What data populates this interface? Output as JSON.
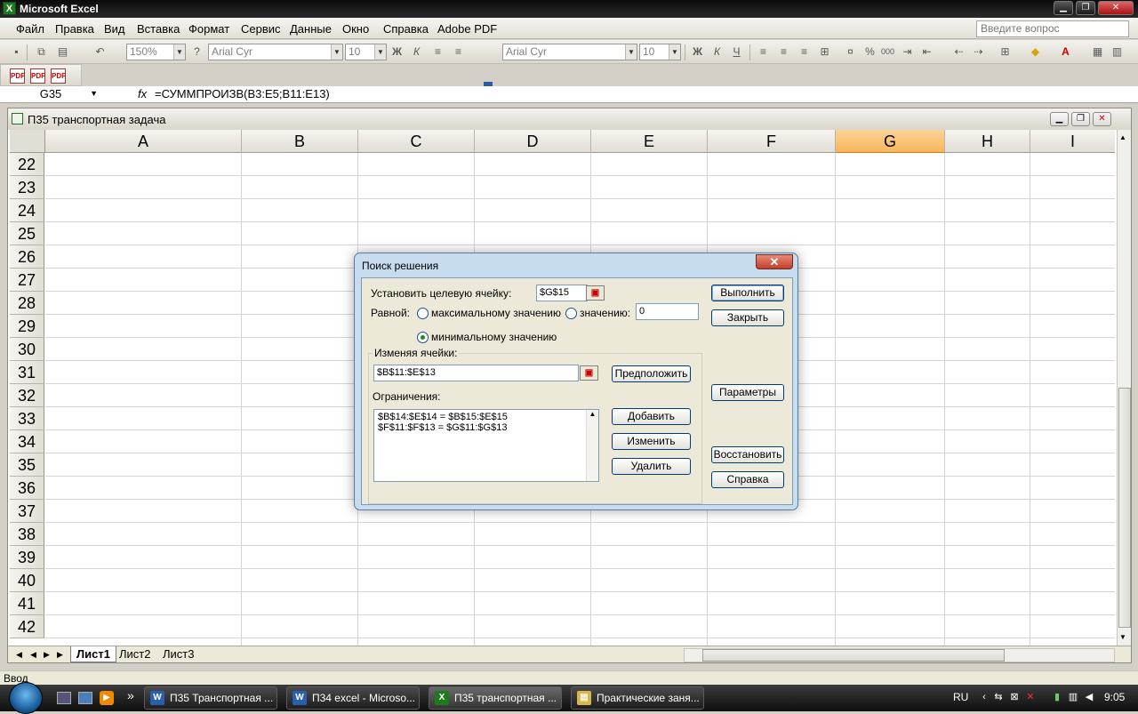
{
  "window": {
    "title": "Microsoft Excel",
    "app_icon": "X"
  },
  "menu": {
    "items": [
      "Файл",
      "Правка",
      "Вид",
      "Вставка",
      "Формат",
      "Сервис",
      "Данные",
      "Окно",
      "Справка",
      "Adobe PDF"
    ],
    "ask_placeholder": "Введите вопрос"
  },
  "toolbar": {
    "zoom": "150%",
    "font1": "Arial Cyr",
    "size1": "10",
    "font2": "Arial Cyr",
    "size2": "10",
    "bold": "Ж",
    "italic": "К",
    "underline": "Ч",
    "percent": "%",
    "thousands": "000"
  },
  "formula_bar": {
    "cell": "G35",
    "fx": "fx",
    "formula": "=СУММПРОИЗВ(B3:E5;B11:E13)"
  },
  "workbook": {
    "title": "П35 транспортная задача",
    "columns": [
      "A",
      "B",
      "C",
      "D",
      "E",
      "F",
      "G",
      "H",
      "I"
    ],
    "rows": [
      "22",
      "23",
      "24",
      "25",
      "26",
      "27",
      "28",
      "29",
      "30",
      "31",
      "32",
      "33",
      "34",
      "35",
      "36",
      "37",
      "38",
      "39",
      "40",
      "41",
      "42"
    ],
    "tabs": [
      "Лист1",
      "Лист2",
      "Лист3"
    ]
  },
  "status": {
    "text": "Ввод"
  },
  "dialog": {
    "title": "Поиск решения",
    "target_label": "Установить целевую ячейку:",
    "target_value": "$G$15",
    "equal_label": "Равной:",
    "max_label": "максимальному значению",
    "value_label": "значению:",
    "value_input": "0",
    "min_label": "минимальному значению",
    "changing_label": "Изменяя ячейки:",
    "changing_value": "$B$11:$E$13",
    "guess_button": "Предположить",
    "constraints_label": "Ограничения:",
    "constraints": [
      "$B$14:$E$14 = $B$15:$E$15",
      "$F$11:$F$13 = $G$11:$G$13"
    ],
    "add_button": "Добавить",
    "change_button": "Изменить",
    "delete_button": "Удалить",
    "solve_button": "Выполнить",
    "close_button": "Закрыть",
    "options_button": "Параметры",
    "reset_button": "Восстановить",
    "help_button": "Справка"
  },
  "taskbar": {
    "tasks": [
      "П35 Транспортная ...",
      "П34 excel - Microso...",
      "П35 транспортная ...",
      "Практические заня..."
    ],
    "lang": "RU",
    "clock": "9:05"
  }
}
